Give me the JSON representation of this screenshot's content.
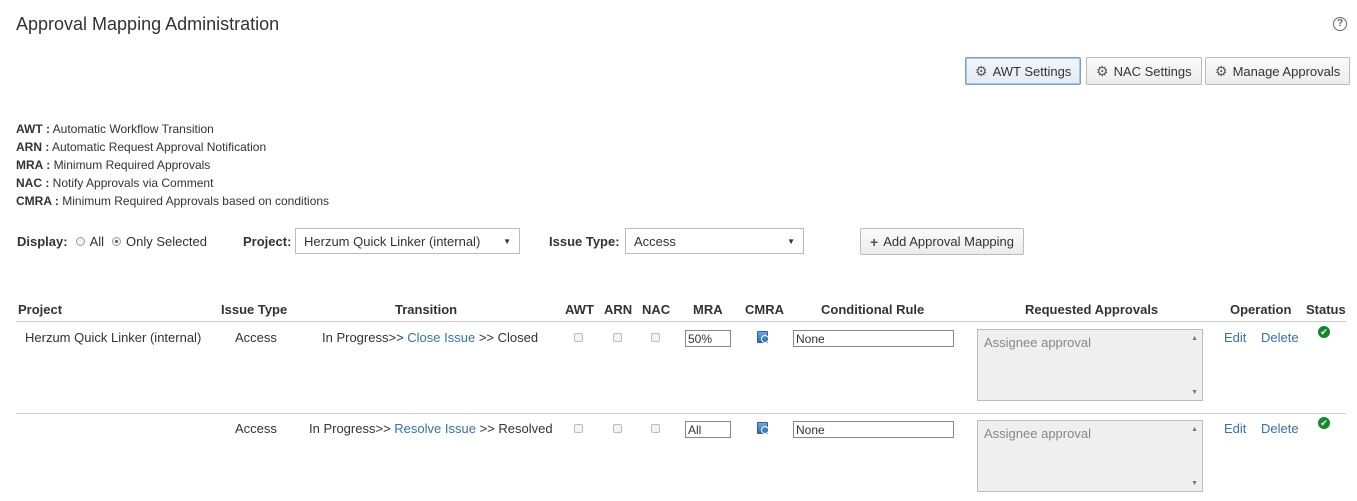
{
  "header": {
    "title": "Approval Mapping Administration",
    "help_icon": "question-circle-icon",
    "help_glyph": "?"
  },
  "toolbar": {
    "awt_settings": "AWT Settings",
    "nac_settings": "NAC Settings",
    "manage_approvals": "Manage Approvals",
    "gear_icon": "gear-icon",
    "gear_glyph": "⚙"
  },
  "legend": [
    {
      "abbr": "AWT :",
      "desc": "Automatic Workflow Transition"
    },
    {
      "abbr": "ARN :",
      "desc": "Automatic Request Approval Notification"
    },
    {
      "abbr": "MRA :",
      "desc": "Minimum Required Approvals"
    },
    {
      "abbr": "NAC :",
      "desc": "Notify Approvals via Comment"
    },
    {
      "abbr": "CMRA :",
      "desc": "Minimum Required Approvals based on conditions"
    }
  ],
  "filters": {
    "display_label": "Display:",
    "option_all": "All",
    "option_selected": "Only Selected",
    "selected_option": "Only Selected",
    "project_label": "Project:",
    "project_value": "Herzum Quick Linker (internal)",
    "issue_type_label": "Issue Type:",
    "issue_type_value": "Access",
    "add_button": "Add Approval Mapping",
    "plus_glyph": "+",
    "arrow_glyph": "▼"
  },
  "table": {
    "headers": {
      "project": "Project",
      "issue_type": "Issue Type",
      "transition": "Transition",
      "awt": "AWT",
      "arn": "ARN",
      "nac": "NAC",
      "mra": "MRA",
      "cmra": "CMRA",
      "conditional_rule": "Conditional Rule",
      "requested_approvals": "Requested Approvals",
      "operation": "Operation",
      "status": "Status"
    },
    "rows": [
      {
        "project": "Herzum Quick Linker (internal)",
        "issue_type": "Access",
        "from_status": "In Progress>>",
        "transition": "Close Issue",
        "to_status": ">> Closed",
        "awt": false,
        "arn": false,
        "nac": false,
        "mra": "50%",
        "conditional_rule": "None",
        "requested_approvals": "Assignee approval",
        "edit": "Edit",
        "delete": "Delete",
        "status": "ok",
        "status_glyph": "✔"
      },
      {
        "project": "",
        "issue_type": "Access",
        "from_status": "In Progress>>",
        "transition": "Resolve Issue",
        "to_status": ">> Resolved",
        "awt": false,
        "arn": false,
        "nac": false,
        "mra": "All",
        "conditional_rule": "None",
        "requested_approvals": "Assignee approval",
        "edit": "Edit",
        "delete": "Delete",
        "status": "ok",
        "status_glyph": "✔"
      }
    ],
    "scroll_up_glyph": "▲",
    "scroll_down_glyph": "▼"
  }
}
